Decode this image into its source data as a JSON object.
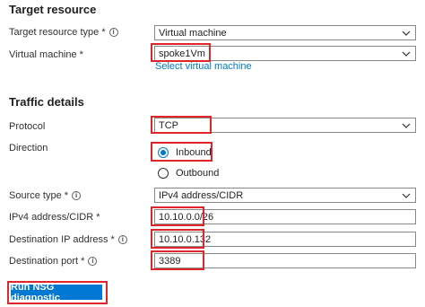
{
  "target_resource": {
    "section_title": "Target resource",
    "type_label": "Target resource type *",
    "type_value": "Virtual machine",
    "vm_label": "Virtual machine *",
    "vm_value": "spoke1Vm",
    "select_vm_link": "Select virtual machine"
  },
  "traffic_details": {
    "section_title": "Traffic details",
    "protocol_label": "Protocol",
    "protocol_value": "TCP",
    "direction_label": "Direction",
    "direction_options": [
      "Inbound",
      "Outbound"
    ],
    "direction_selected": "Inbound",
    "source_type_label": "Source type *",
    "source_type_value": "IPv4 address/CIDR",
    "ipv4_label": "IPv4 address/CIDR *",
    "ipv4_value": "10.10.0.0/26",
    "dest_ip_label": "Destination IP address *",
    "dest_ip_value": "10.10.0.132",
    "dest_port_label": "Destination port *",
    "dest_port_value": "3389"
  },
  "actions": {
    "run_label": "Run NSG diagnostic"
  },
  "colors": {
    "accent": "#0078d4",
    "highlight": "#e0262a"
  },
  "icons": {
    "info": "info-circle-icon",
    "dropdown": "chevron-down-icon"
  }
}
